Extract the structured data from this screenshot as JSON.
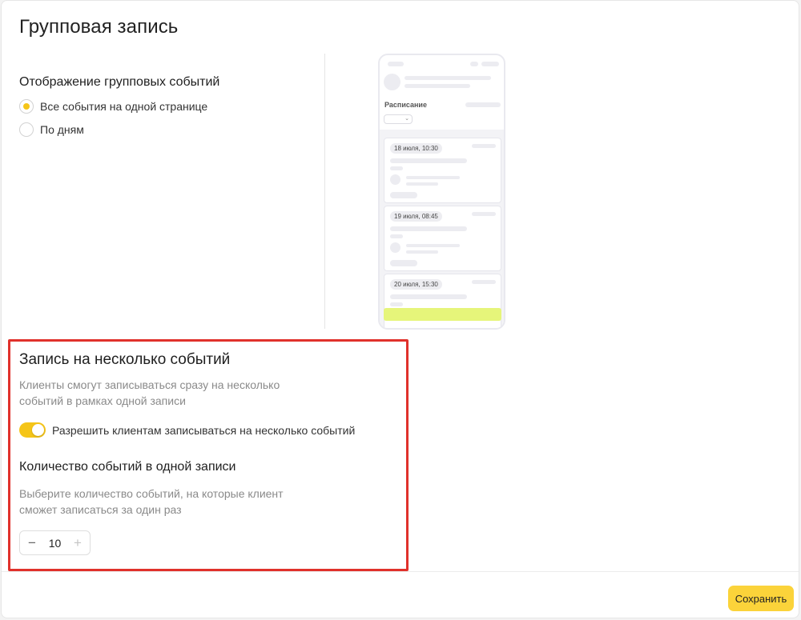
{
  "page": {
    "title": "Групповая запись"
  },
  "display_section": {
    "heading": "Отображение групповых событий",
    "options": [
      {
        "label": "Все события на одной странице",
        "selected": true
      },
      {
        "label": "По дням",
        "selected": false
      }
    ]
  },
  "preview": {
    "schedule_label": "Расписание",
    "select_arrow": "⌄",
    "cards": [
      {
        "datetime": "18 июля, 10:30"
      },
      {
        "datetime": "19 июля, 08:45"
      },
      {
        "datetime": "20 июля, 15:30"
      }
    ],
    "cta_color": "#e6f57a"
  },
  "multi_booking": {
    "heading": "Запись на несколько событий",
    "description_lines": [
      "Клиенты смогут записываться сразу на несколько",
      "событий в рамках одной записи"
    ],
    "toggle_label": "Разрешить клиентам записываться на несколько событий",
    "toggle_on": true,
    "count_heading": "Количество событий в одной записи",
    "count_description_lines": [
      "Выберите количество событий, на которые клиент",
      "сможет записаться за один раз"
    ],
    "stepper": {
      "minus": "−",
      "value": "10",
      "plus": "+"
    }
  },
  "footer": {
    "save_label": "Сохранить"
  },
  "colors": {
    "accent": "#f5c518",
    "save_button": "#fbd33a",
    "highlight_border": "#e0312b"
  }
}
